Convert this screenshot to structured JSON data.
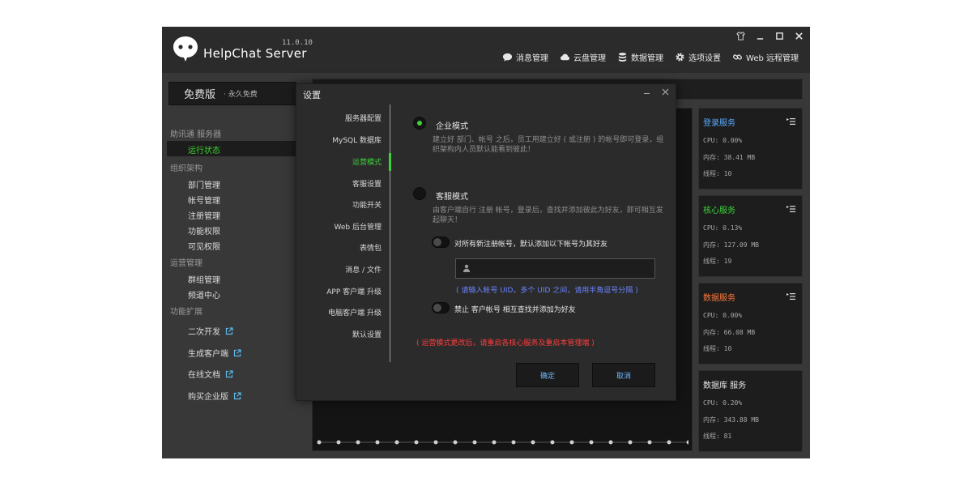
{
  "app": {
    "name": "HelpChat Server",
    "version": "11.0.10"
  },
  "topnav": [
    {
      "label": "消息管理",
      "icon": "chat-bubble-icon"
    },
    {
      "label": "云盘管理",
      "icon": "cloud-icon"
    },
    {
      "label": "数据管理",
      "icon": "database-icon"
    },
    {
      "label": "选项设置",
      "icon": "gear-icon"
    },
    {
      "label": "Web 远程管理",
      "icon": "link-icon"
    }
  ],
  "sidebar": {
    "edition_main": "免费版",
    "edition_sub": "· 永久免费",
    "sections": [
      {
        "title": "助讯通 服务器",
        "items": [
          "运行状态"
        ]
      },
      {
        "title": "组织架构",
        "items": [
          "部门管理",
          "帐号管理",
          "注册管理",
          "功能权限",
          "可见权限"
        ]
      },
      {
        "title": "运营管理",
        "items": [
          "群组管理",
          "频道中心"
        ]
      },
      {
        "title": "功能扩展",
        "items": [
          "二次开发",
          "生成客户端",
          "在线文档",
          "购买企业版"
        ]
      }
    ],
    "active_item": "运行状态"
  },
  "services": [
    {
      "name": "登录服务",
      "color": "#5aa9ff",
      "cpu": "CPU: 0.00%",
      "mem": "内存: 38.41 MB",
      "threads": "线程: 10"
    },
    {
      "name": "核心服务",
      "color": "#3cd13a",
      "cpu": "CPU: 0.13%",
      "mem": "内存: 127.09 MB",
      "threads": "线程: 19"
    },
    {
      "name": "数据服务",
      "color": "#ff7a3a",
      "cpu": "CPU: 0.00%",
      "mem": "内存: 66.08 MB",
      "threads": "线程: 10"
    },
    {
      "name": "数据库 服务",
      "color": "#e6e6e6",
      "cpu": "CPU: 0.20%",
      "mem": "内存: 343.88 MB",
      "threads": "线程: 81"
    }
  ],
  "dialog": {
    "title": "设置",
    "nav": [
      "服务器配置",
      "MySQL 数据库",
      "运营模式",
      "客服设置",
      "功能开关",
      "Web 后台管理",
      "表情包",
      "消息 / 文件",
      "APP 客户端 升级",
      "电脑客户端 升级",
      "默认设置"
    ],
    "active_nav": "运营模式",
    "enterprise_label": "企业模式",
    "enterprise_desc": "建立好 部门、帐号 之后，员工用建立好 ( 或注册 ) 的帐号即可登录，组织架构内人员默认能看到彼此！",
    "service_label": "客服模式",
    "service_desc": "由客户端自行 注册 帐号，登录后，查找并添加彼此为好友，即可相互发起聊天！",
    "toggle1_label": "对所有新注册帐号，默认添加以下帐号为其好友",
    "uid_placeholder": "",
    "uid_hint": "( 请输入帐号 UID，多个 UID 之间，请用半角逗号分隔 )",
    "toggle2_label": "禁止 客户帐号 相互查找并添加为好友",
    "warning": "( 运营模式更改后，请重启各核心服务及重启本管理端 )",
    "ok_label": "确定",
    "cancel_label": "取消"
  }
}
